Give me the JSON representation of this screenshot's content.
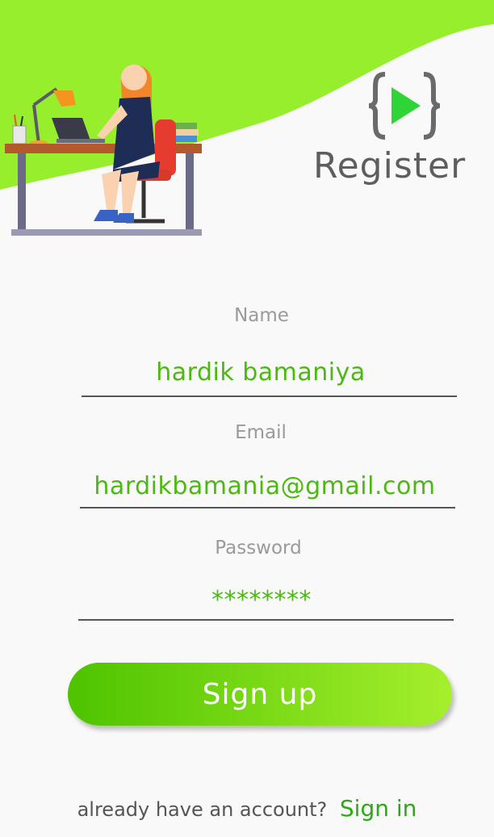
{
  "header": {
    "title": "Register",
    "logo_icon": "code-play-icon",
    "illustration_icon": "woman-at-desk-illustration",
    "accent_color": "#8fe63a",
    "logo_play_color": "#2fd437"
  },
  "form": {
    "name": {
      "label": "Name",
      "value": "hardik bamaniya"
    },
    "email": {
      "label": "Email",
      "value": "hardikbamania@gmail.com"
    },
    "password": {
      "label": "Password",
      "value": "********"
    }
  },
  "actions": {
    "signup_label": "Sign up"
  },
  "footer": {
    "prompt": "already have an account?",
    "signin_label": "Sign in"
  }
}
